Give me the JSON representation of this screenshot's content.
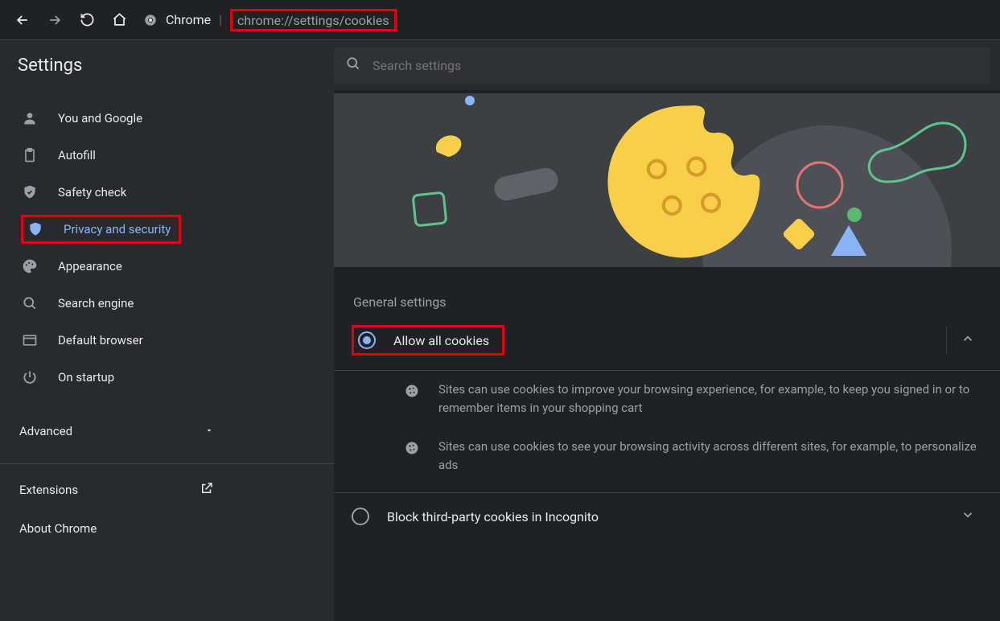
{
  "toolbar": {
    "chrome_label": "Chrome",
    "url_pre": "chrome://",
    "url_mid": "settings",
    "url_post": "/cookies"
  },
  "header": {
    "title": "Settings",
    "search_placeholder": "Search settings"
  },
  "sidebar": {
    "items": [
      {
        "label": "You and Google"
      },
      {
        "label": "Autofill"
      },
      {
        "label": "Safety check"
      },
      {
        "label": "Privacy and security"
      },
      {
        "label": "Appearance"
      },
      {
        "label": "Search engine"
      },
      {
        "label": "Default browser"
      },
      {
        "label": "On startup"
      }
    ],
    "advanced": "Advanced",
    "extensions": "Extensions",
    "about": "About Chrome"
  },
  "main": {
    "general_label": "General settings",
    "option1": "Allow all cookies",
    "desc1": "Sites can use cookies to improve your browsing experience, for example, to keep you signed in or to remember items in your shopping cart",
    "desc2": "Sites can use cookies to see your browsing activity across different sites, for example, to personalize ads",
    "option2": "Block third-party cookies in Incognito"
  }
}
